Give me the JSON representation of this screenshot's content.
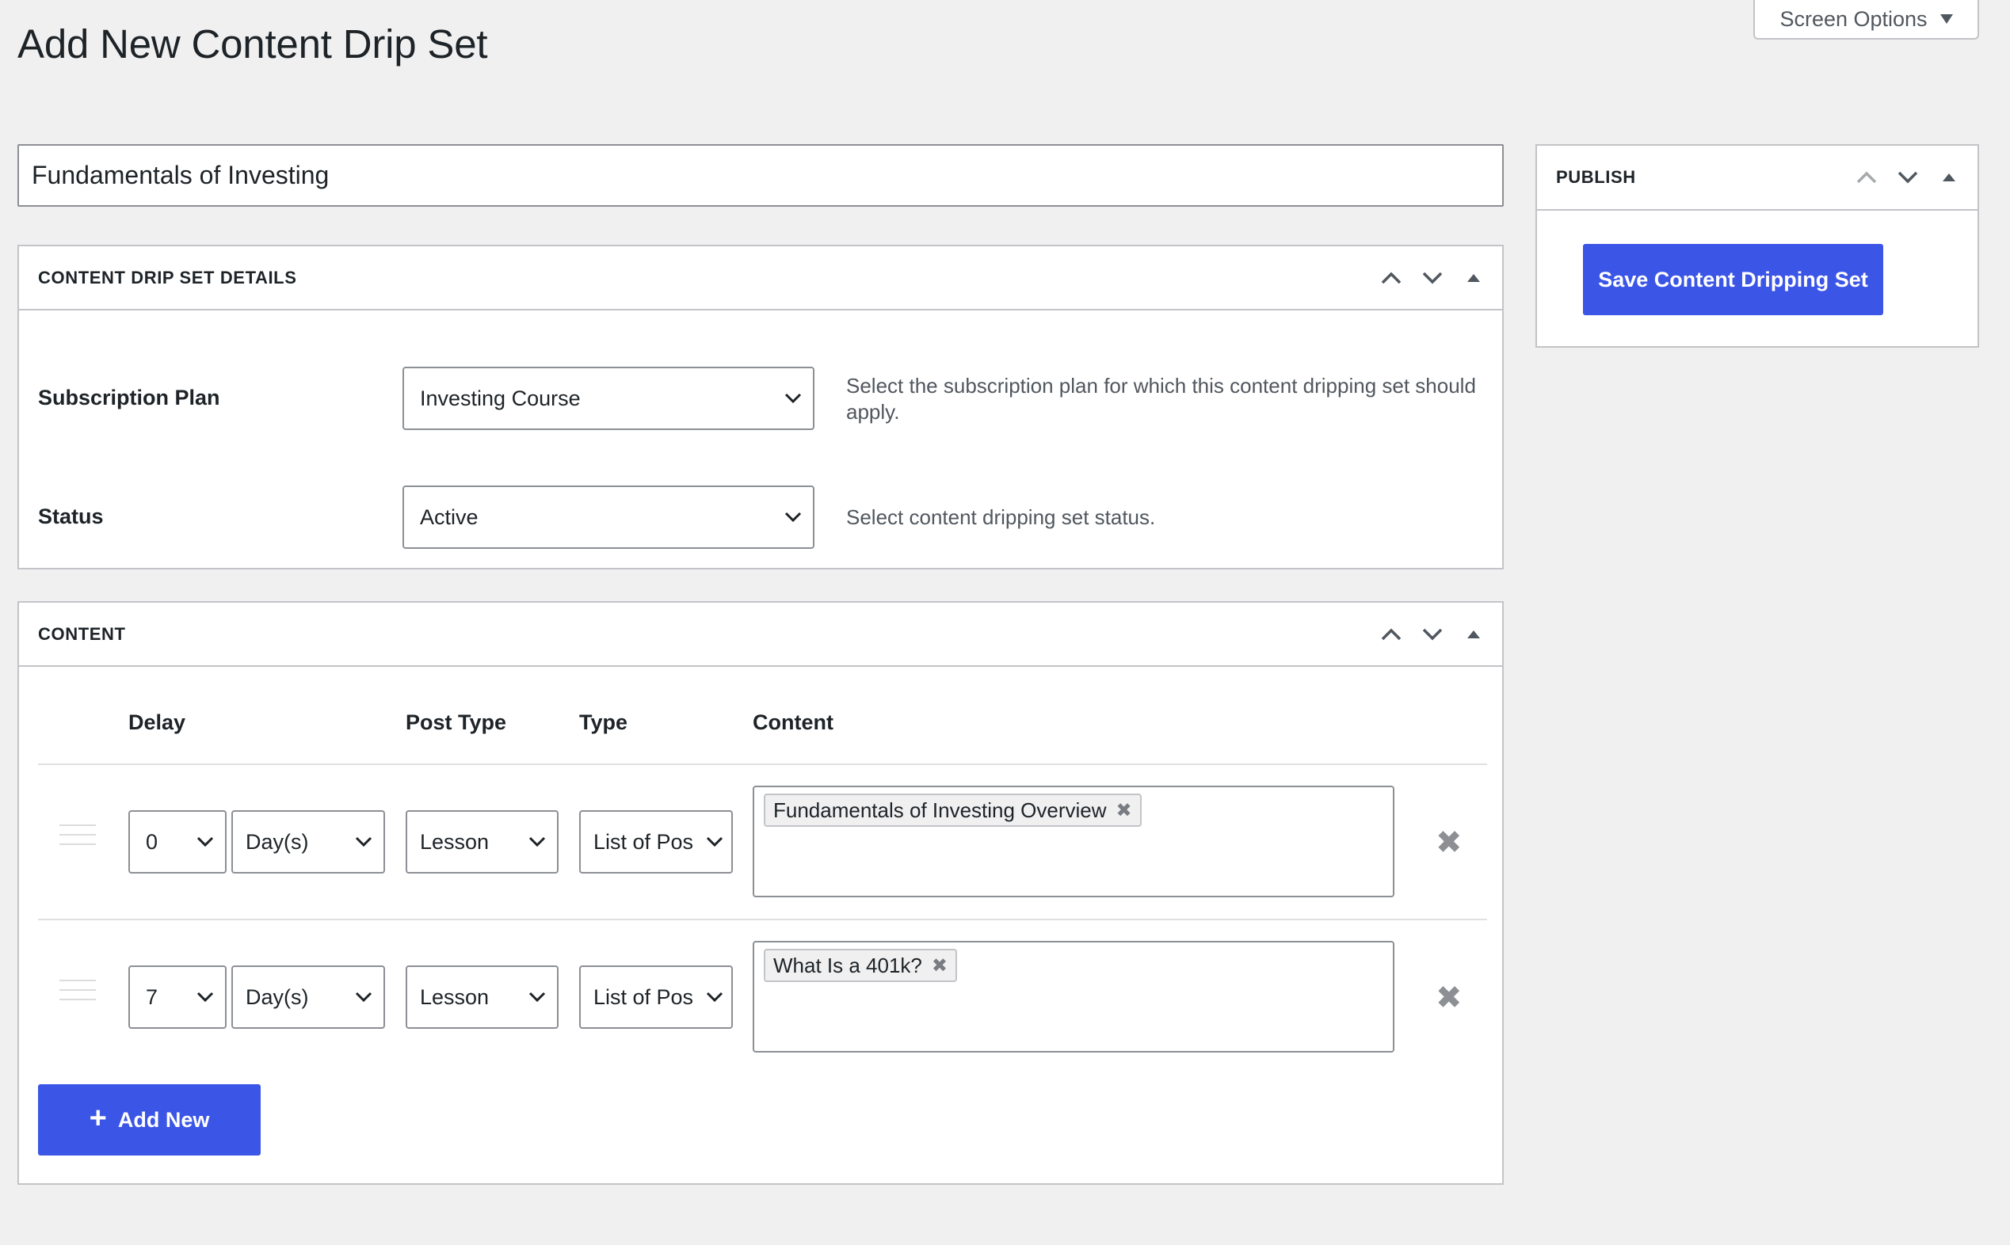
{
  "page": {
    "title": "Add New Content Drip Set",
    "screen_options_label": "Screen Options"
  },
  "title_field": {
    "value": "Fundamentals of Investing"
  },
  "details_box": {
    "title": "CONTENT DRIP SET DETAILS",
    "subscription_plan": {
      "label": "Subscription Plan",
      "value": "Investing Course",
      "description": "Select the subscription plan for which this content dripping set should apply."
    },
    "status": {
      "label": "Status",
      "value": "Active",
      "description": "Select content dripping set status."
    }
  },
  "content_box": {
    "title": "CONTENT",
    "columns": [
      "Delay",
      "Post Type",
      "Type",
      "Content"
    ],
    "rows": [
      {
        "delay": "0",
        "unit": "Day(s)",
        "post_type": "Lesson",
        "type": "List of Pos",
        "content_tag": "Fundamentals of Investing Overview"
      },
      {
        "delay": "7",
        "unit": "Day(s)",
        "post_type": "Lesson",
        "type": "List of Pos",
        "content_tag": "What Is a 401k?"
      }
    ],
    "add_new_label": "Add New"
  },
  "publish_box": {
    "title": "PUBLISH",
    "save_label": "Save Content Dripping Set"
  },
  "colors": {
    "primary": "#3b55e6",
    "background": "#f0f0f1",
    "border": "#c3c4c7"
  },
  "icons": [
    "chevron-up-icon",
    "chevron-down-icon",
    "toggle-triangle-icon",
    "drag-handle-icon",
    "remove-icon",
    "plus-icon"
  ]
}
